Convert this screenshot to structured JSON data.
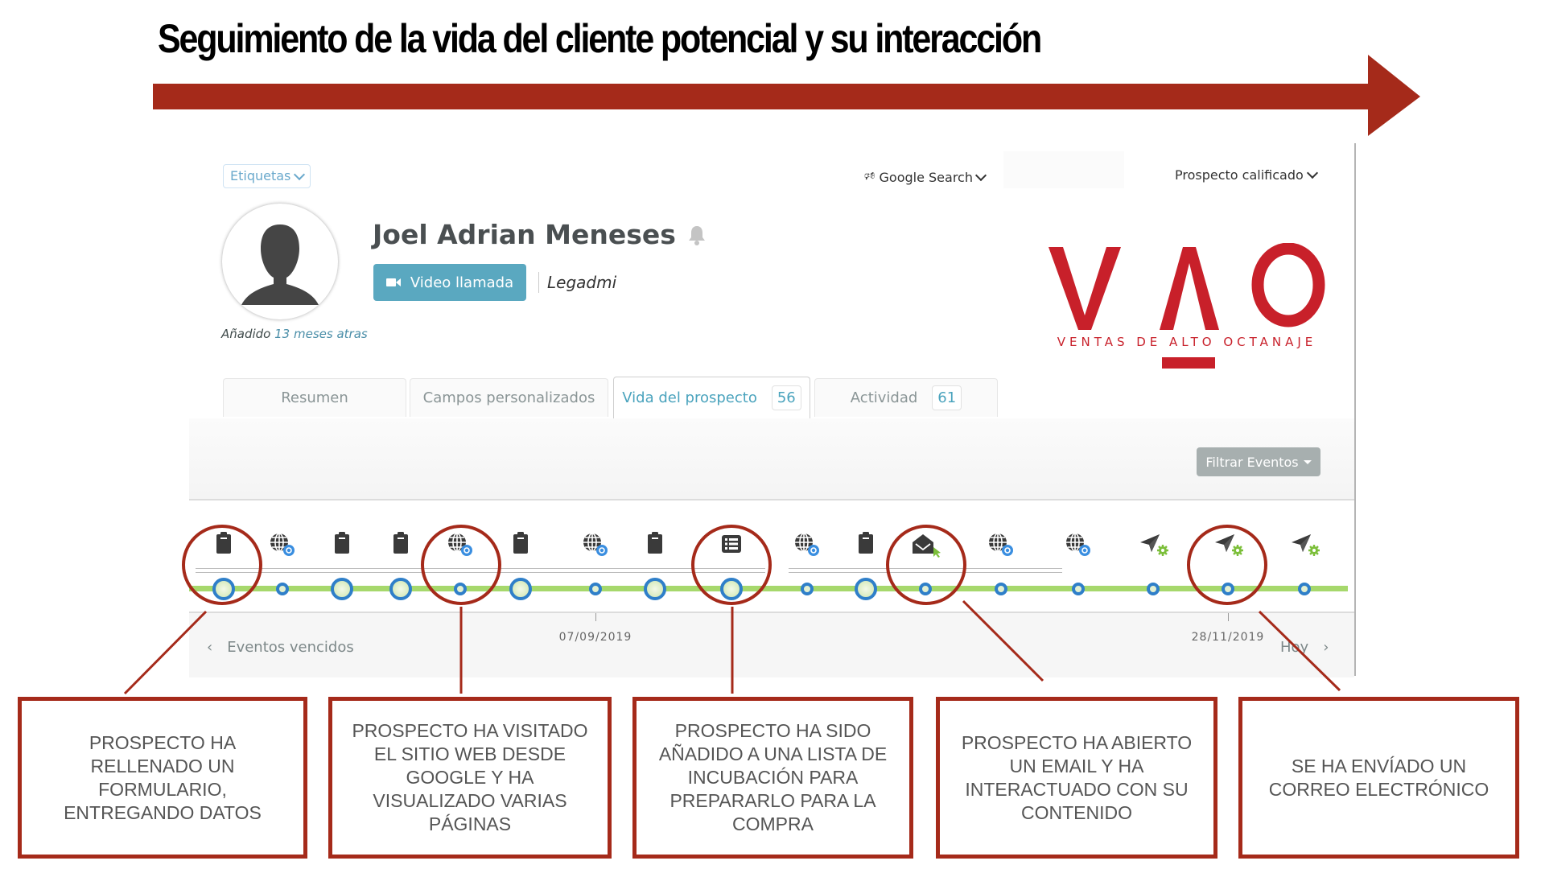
{
  "slide": {
    "title": "Seguimiento de la vida del cliente potencial y su interacción",
    "accent_color": "#a52a1a"
  },
  "header": {
    "tags_label": "Etiquetas",
    "source_label": "Google Search",
    "stage_label": "Prospecto calificado"
  },
  "contact": {
    "name": "Joel Adrian Meneses",
    "video_call_label": "Video llamada",
    "owner": "Legadmi",
    "added_prefix": "Añadido",
    "added_ago": "13 meses atras"
  },
  "logo": {
    "letters": "V",
    "letter_a": "Λ",
    "letter_o": "O",
    "tagline": "VENTAS DE ALTO OCTANAJE",
    "color": "#c8202a"
  },
  "tabs": [
    {
      "label": "Resumen",
      "badge": null,
      "active": false
    },
    {
      "label": "Campos personalizados",
      "badge": null,
      "active": false
    },
    {
      "label": "Vida del prospecto",
      "badge": "56",
      "active": true
    },
    {
      "label": "Actividad",
      "badge": "61",
      "active": false
    }
  ],
  "filter": {
    "label": "Filtrar Eventos"
  },
  "timeline": {
    "events": [
      {
        "type": "form",
        "icon": "clipboard-icon",
        "dot": "big"
      },
      {
        "type": "web-visit",
        "icon": "globe-chrome-icon",
        "dot": "small"
      },
      {
        "type": "form",
        "icon": "clipboard-icon",
        "dot": "big"
      },
      {
        "type": "form",
        "icon": "clipboard-icon",
        "dot": "big"
      },
      {
        "type": "web-visit",
        "icon": "globe-chrome-icon",
        "dot": "small"
      },
      {
        "type": "form",
        "icon": "clipboard-icon",
        "dot": "big"
      },
      {
        "type": "web-visit",
        "icon": "globe-chrome-icon",
        "dot": "small"
      },
      {
        "type": "form",
        "icon": "clipboard-icon",
        "dot": "big"
      },
      {
        "type": "list-added",
        "icon": "list-icon",
        "dot": "big"
      },
      {
        "type": "web-visit",
        "icon": "globe-chrome-icon",
        "dot": "small"
      },
      {
        "type": "form",
        "icon": "clipboard-icon",
        "dot": "big"
      },
      {
        "type": "email-open",
        "icon": "envelope-open-click-icon",
        "dot": "small"
      },
      {
        "type": "web-visit",
        "icon": "globe-chrome-icon",
        "dot": "small"
      },
      {
        "type": "web-visit",
        "icon": "globe-chrome-icon",
        "dot": "small"
      },
      {
        "type": "email-sent",
        "icon": "paper-plane-gear-icon",
        "dot": "small"
      },
      {
        "type": "email-sent",
        "icon": "paper-plane-gear-icon",
        "dot": "small"
      },
      {
        "type": "email-sent",
        "icon": "paper-plane-gear-icon",
        "dot": "small"
      }
    ],
    "dates": [
      "07/09/2019",
      "28/11/2019"
    ],
    "prev_label": "Eventos vencidos",
    "today_label": "Hoy",
    "track_color": "#a6d86c",
    "dot_color": "#2f7fc9"
  },
  "annotations": [
    {
      "text": "Prospecto ha rellenado un formulario, entregando datos"
    },
    {
      "text": "Prospecto ha visitado el sitio web desde Google y ha visualizado varias páginas"
    },
    {
      "text": "Prospecto ha sido añadido a una lista de incubación para prepararlo para la compra"
    },
    {
      "text": "Prospecto ha abierto un email y ha interactuado con su contenido"
    },
    {
      "text": "Se ha envíado un correo electrónico"
    }
  ]
}
